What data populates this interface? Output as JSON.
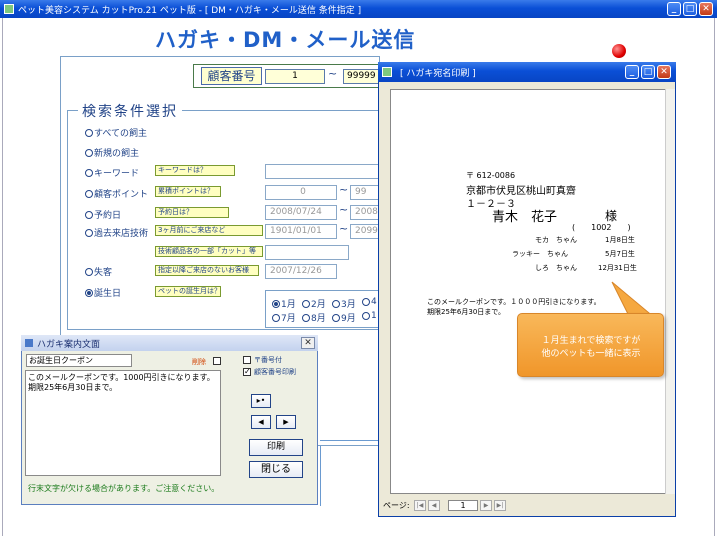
{
  "main_window": {
    "title": "ペット美容システム カットPro.21 ペット版 - [ DM・ハガキ・メール送信 条件指定 ]"
  },
  "page_title": "ハガキ・DM・メール送信",
  "customer_no": {
    "label": "顧客番号",
    "from": "1",
    "to": "99999"
  },
  "search_section": {
    "title": "検索条件選択"
  },
  "conditions": [
    {
      "label": "すべての飼主",
      "selected": false
    },
    {
      "label": "新規の飼主",
      "selected": false
    },
    {
      "label": "キーワード",
      "selected": false,
      "hint": "キーワードは？"
    },
    {
      "label": "顧客ポイント",
      "selected": false,
      "hint": "累積ポイントは？",
      "from": "0",
      "to": "99"
    },
    {
      "label": "予約日",
      "selected": false,
      "hint": "予約日は？",
      "from": "2008/07/24",
      "to": "2008"
    },
    {
      "label": "過去来店技術",
      "selected": false,
      "hint": "3ヶ月前にご来店など",
      "from": "1901/01/01",
      "to": "2099"
    },
    {
      "label": "失客",
      "selected": false,
      "hint": "指定以降ご来店のないお客様",
      "date": "2007/12/26"
    },
    {
      "label": "誕生日",
      "selected": true,
      "hint": "ペットの誕生月は？"
    }
  ],
  "tech_hint": "技術顧品名の一部「カット」等",
  "months_row1": [
    "1月",
    "2月",
    "3月",
    "4"
  ],
  "months_row2": [
    "7月",
    "8月",
    "9月",
    "1"
  ],
  "guide_dialog": {
    "title": "ハガキ案内文面",
    "subject": "お誕生日クーポン",
    "delete_label": "削除",
    "body_line1": "このメールクーポンです。1000円引きになります。",
    "body_line2": "期限25年6月30日まで。",
    "chk_postal": "〒番号付",
    "chk_custno": "顧客番号印刷",
    "btn_print": "印刷",
    "btn_close": "閉じる",
    "footer": "行末文字が欠ける場合があります。ご注意ください。"
  },
  "preview_window": {
    "title": "[ ハガキ宛名印刷 ]",
    "postal": "〒 612-0086",
    "addr1": "京都市伏見区桃山町真齋",
    "addr2": "１－２－３",
    "name": "青木　花子",
    "honorific": "様",
    "custno": "(　　1002　　)",
    "pets": [
      {
        "name": "モカ　ちゃん",
        "bday": "1月8日生"
      },
      {
        "name": "ラッキー　ちゃん",
        "bday": "5月7日生"
      },
      {
        "name": "しろ　ちゃん",
        "bday": "12月31日生"
      }
    ],
    "msg1": "このメールクーポンです。１０００円引きになります。",
    "msg2": "期限25年6月30日まで。",
    "page_label": "ページ:",
    "page_no": "1"
  },
  "callout": {
    "line1": "１月生まれで検索ですが",
    "line2": "他のペットも一緒に表示"
  }
}
